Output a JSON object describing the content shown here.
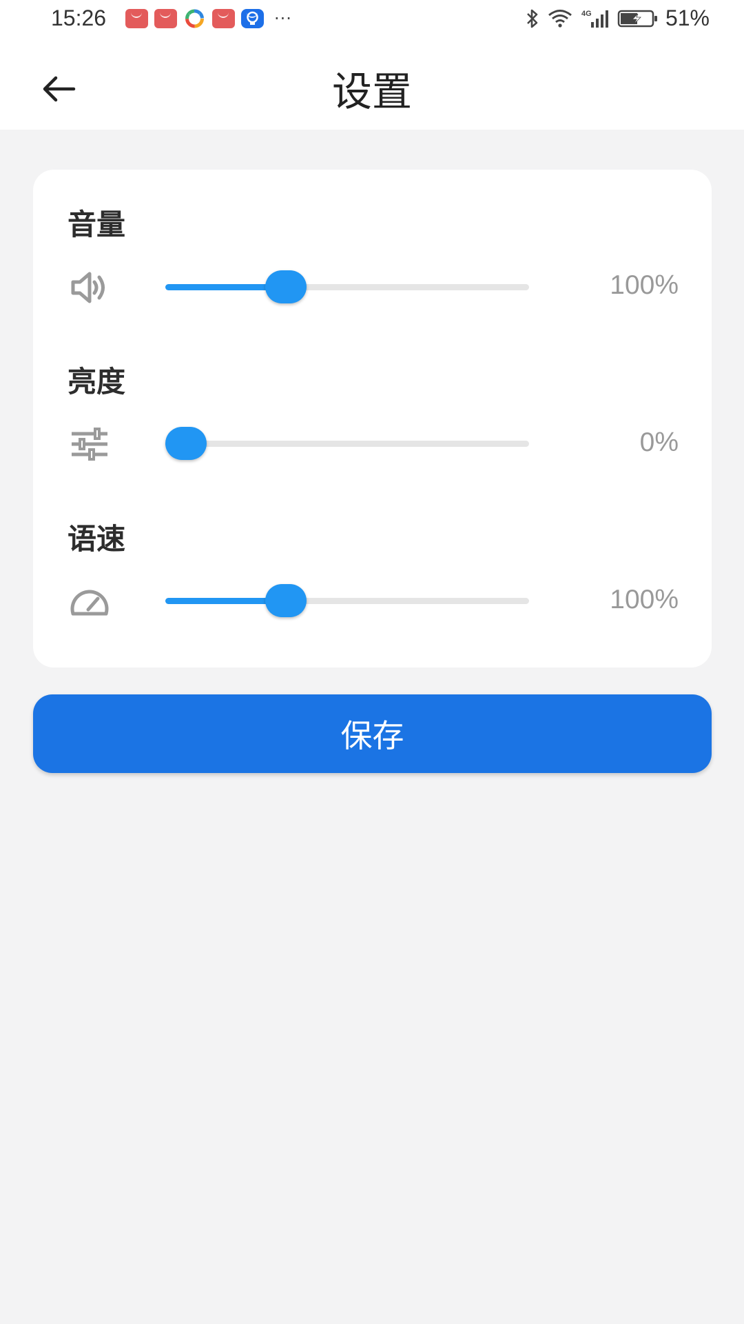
{
  "status_bar": {
    "time": "15:26",
    "more": "···",
    "battery": "51%"
  },
  "header": {
    "title": "设置"
  },
  "settings": {
    "volume": {
      "label": "音量",
      "value_text": "100%",
      "level": 0.31
    },
    "brightness": {
      "label": "亮度",
      "value_text": "0%",
      "level": 0.0
    },
    "speech_rate": {
      "label": "语速",
      "value_text": "100%",
      "level": 0.31
    }
  },
  "save_label": "保存",
  "colors": {
    "accent": "#2196f3",
    "button": "#1b74e4",
    "background": "#f3f3f4"
  }
}
